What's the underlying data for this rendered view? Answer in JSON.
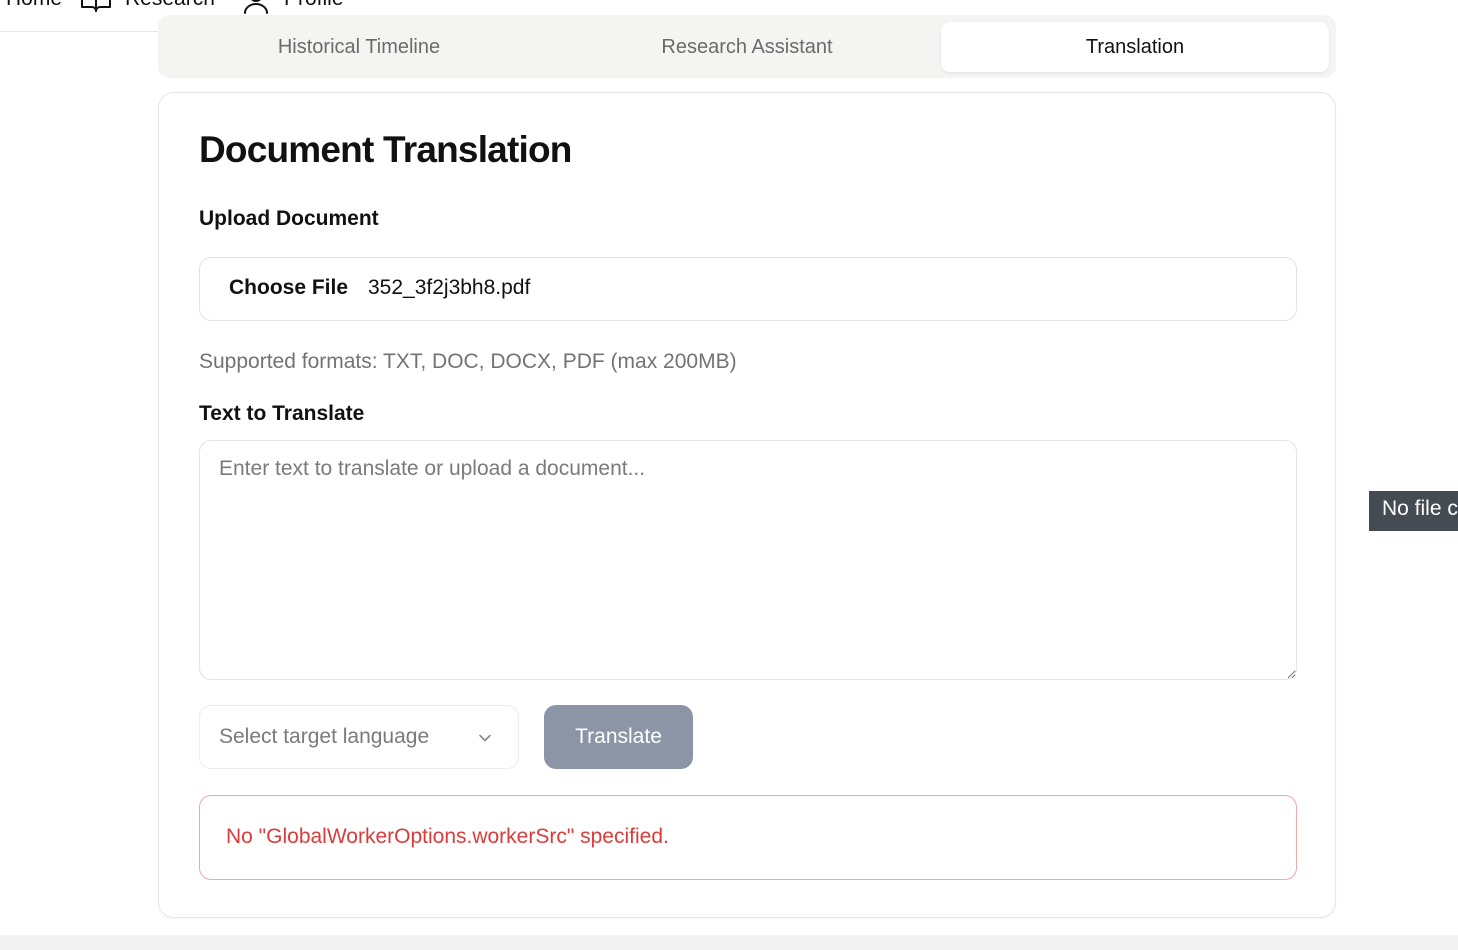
{
  "nav": {
    "items": [
      {
        "label": "Home",
        "icon": "home-icon"
      },
      {
        "label": "Research",
        "icon": "book-icon"
      },
      {
        "label": "Profile",
        "icon": "user-icon"
      }
    ]
  },
  "tabs": [
    {
      "label": "Historical Timeline",
      "active": false
    },
    {
      "label": "Research Assistant",
      "active": false
    },
    {
      "label": "Translation",
      "active": true
    }
  ],
  "card": {
    "title": "Document Translation",
    "upload": {
      "label": "Upload Document",
      "button_label": "Choose File",
      "file_name": "352_3f2j3bh8.pdf",
      "hint": "Supported formats: TXT, DOC, DOCX, PDF (max 200MB)"
    },
    "text": {
      "label": "Text to Translate",
      "value": "",
      "placeholder": "Enter text to translate or upload a document..."
    },
    "language_select": {
      "placeholder": "Select target language",
      "icon": "chevron-down-icon"
    },
    "translate_button": "Translate",
    "error": "No \"GlobalWorkerOptions.workerSrc\" specified."
  },
  "tooltip": "No file chosen",
  "colors": {
    "error": "#dc3b3b",
    "error_border": "#f0a8a8",
    "button_disabled": "#8c95a5",
    "tooltip_bg": "#454b52"
  }
}
